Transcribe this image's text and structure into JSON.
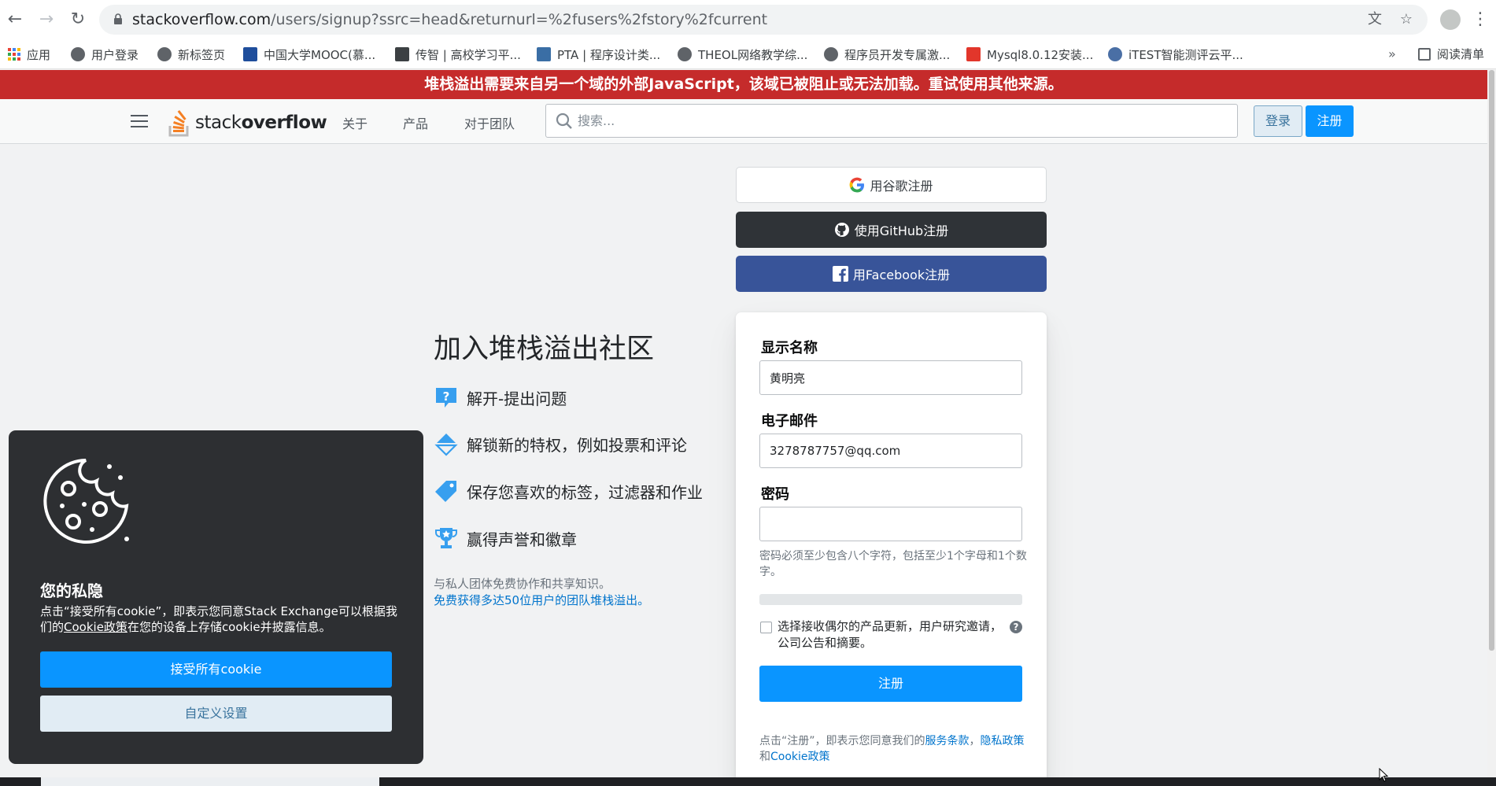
{
  "browser": {
    "url_host": "stackoverflow.com",
    "url_path": "/users/signup?ssrc=head&returnurl=%2fusers%2fstory%2fcurrent",
    "bookmarks": [
      "应用",
      "用户登录",
      "新标签页",
      "中国大学MOOC(慕...",
      "传智 | 高校学习平...",
      "PTA | 程序设计类...",
      "THEOL网络教学综...",
      "程序员开发专属激...",
      "Mysql8.0.12安装...",
      "iTEST智能测评云平..."
    ],
    "overflow_chevron": "»",
    "reading_list": "阅读清单"
  },
  "banner": {
    "text": "堆栈溢出需要来自另一个域的外部JavaScript，该域已被阻止或无法加载。重试使用其他来源。"
  },
  "topbar": {
    "logo_regular": "stack",
    "logo_bold": "overflow",
    "nav": [
      "关于",
      "产品",
      "对于团队"
    ],
    "search_placeholder": "搜索...",
    "login": "登录",
    "signup": "注册"
  },
  "intro": {
    "title": "加入堆栈溢出社区",
    "perks": [
      "解开-提出问题",
      "解锁新的特权，例如投票和评论",
      "保存您喜欢的标签，过滤器和作业",
      "赢得声誉和徽章"
    ],
    "team_text": "与私人团体免费协作和共享知识。",
    "team_link": "免费获得多达50位用户的团队堆栈溢出。"
  },
  "social": {
    "google": "用谷歌注册",
    "github": "使用GitHub注册",
    "facebook": "用Facebook注册"
  },
  "form": {
    "display_name_label": "显示名称",
    "display_name_value": "黄明亮",
    "email_label": "电子邮件",
    "email_value": "3278787757@qq.com",
    "password_label": "密码",
    "password_value": "",
    "password_hint": "密码必须至少包含八个字符，包括至少1个字母和1个数字。",
    "opt_in_text": "选择接收偶尔的产品更新，用户研究邀请，公司公告和摘要。",
    "help": "?",
    "submit": "注册",
    "terms_prefix": "点击“注册”，即表示您同意我们的",
    "terms_link1": "服务条款",
    "terms_sep": "，",
    "terms_link2": "隐私政策",
    "terms_and": "和",
    "terms_link3": "Cookie政策"
  },
  "cookie": {
    "title": "您的私隐",
    "body_pre": "点击“接受所有cookie”，即表示您同意Stack Exchange可以根据我们的",
    "body_link": "Cookie政策",
    "body_post": "在您的设备上存储cookie并披露信息。",
    "accept": "接受所有cookie",
    "customize": "自定义设置"
  },
  "colors": {
    "banner_red": "#c52b2b",
    "so_blue": "#0a95ff",
    "so_orange": "#f48024",
    "github_dark": "#2f3337",
    "facebook_blue": "#385499"
  }
}
